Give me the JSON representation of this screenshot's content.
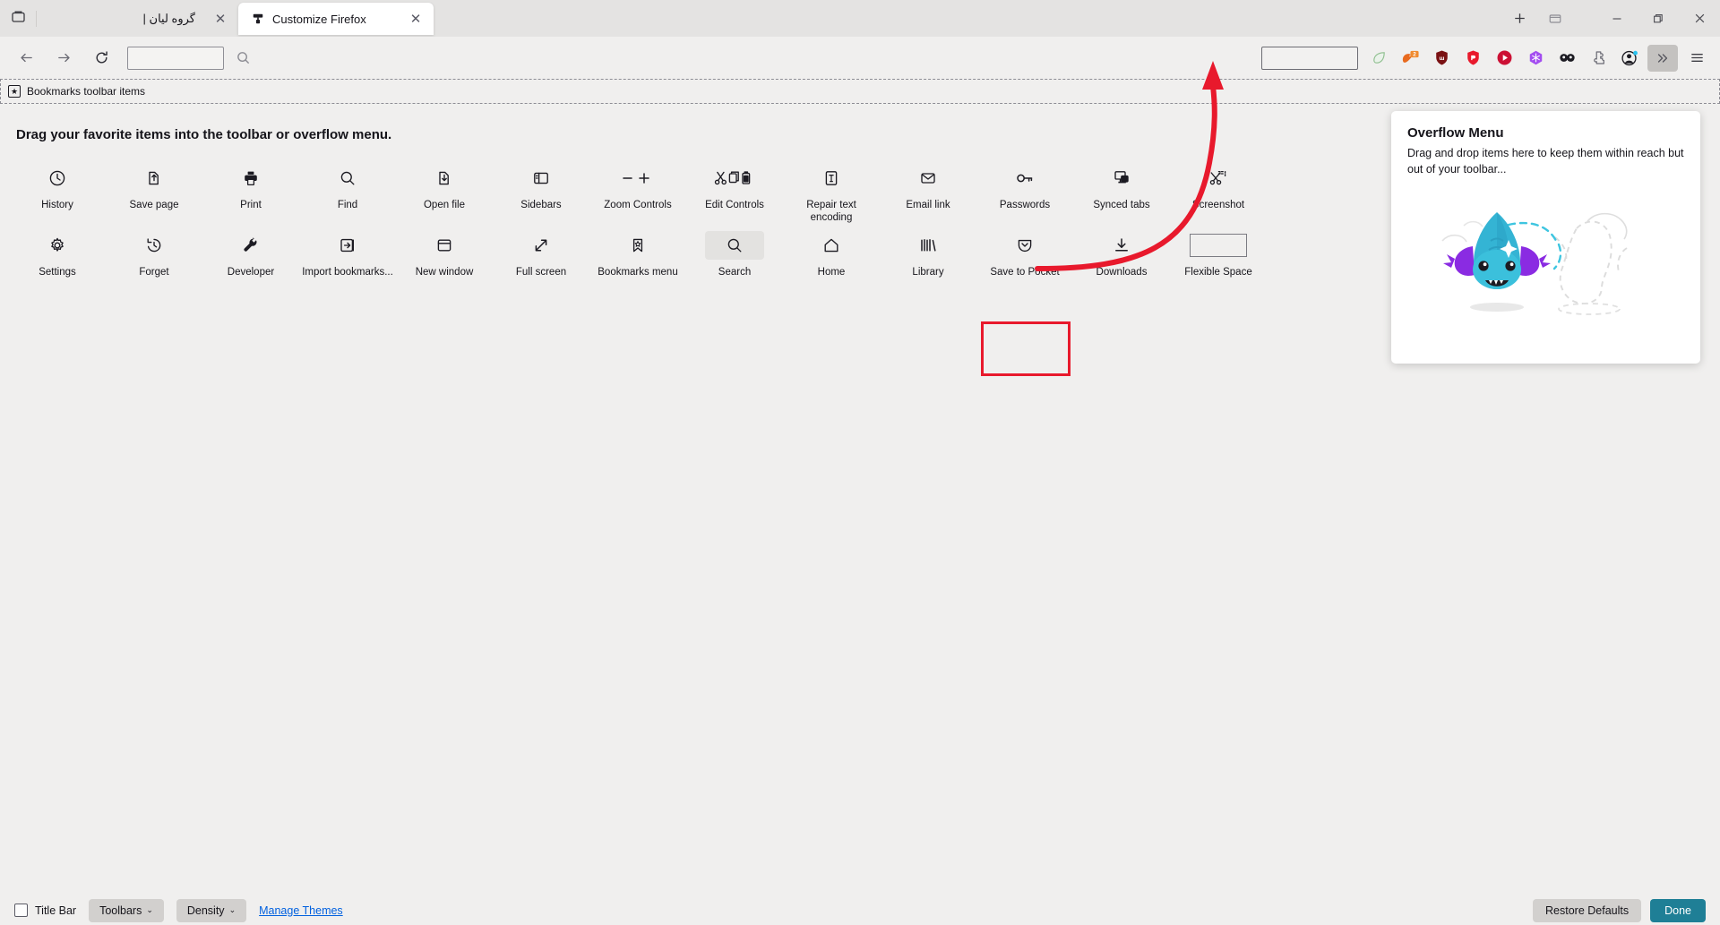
{
  "window": {
    "tab_list_icon": "tab-list-icon",
    "new_tab_label": "+",
    "list_all_tabs_label": "▭",
    "minimize_label": "—",
    "maximize_label": "❐",
    "close_label": "✕"
  },
  "tabs": [
    {
      "title": "گروه لیان |",
      "active": false,
      "close_label": "✕",
      "favicon": "generic-page-icon"
    },
    {
      "title": "Customize Firefox",
      "active": true,
      "close_label": "✕",
      "favicon": "paint-roller-icon"
    }
  ],
  "navbar": {
    "back_icon": "back-arrow-icon",
    "forward_icon": "forward-arrow-icon",
    "reload_icon": "reload-icon",
    "urlbar_value": "",
    "urlbar_placeholder": "",
    "search_icon": "search-icon",
    "secondary_urlbar_value": "",
    "extensions": [
      {
        "name": "leaf-extension-icon",
        "color": "#8fbf8f"
      },
      {
        "name": "firefox-monitor-extension-icon",
        "color": "#e86a1e",
        "badge": "2"
      },
      {
        "name": "ublock-origin-icon",
        "color": "#7a1113"
      },
      {
        "name": "adguard-shield-icon",
        "color": "#e8192c"
      },
      {
        "name": "video-downloader-icon",
        "color": "#cc1034"
      },
      {
        "name": "snowflake-extension-icon",
        "color": "#a34df0"
      },
      {
        "name": "infinity-extension-icon",
        "color": "#1c1b22"
      },
      {
        "name": "extensions-puzzle-icon",
        "color": "#5b5b66"
      },
      {
        "name": "account-avatar-icon",
        "color": "#1c1b22"
      }
    ],
    "overflow_icon": "chevron-double-right-icon",
    "menu_icon": "hamburger-menu-icon"
  },
  "bookmarks_toolbar": {
    "label": "Bookmarks toolbar items",
    "icon": "bookmark-star-icon"
  },
  "customize": {
    "heading": "Drag your favorite items into the toolbar or overflow menu.",
    "palette": [
      {
        "label": "History",
        "icon": "clock-icon",
        "type": "icon"
      },
      {
        "label": "Save page",
        "icon": "save-page-icon",
        "type": "icon"
      },
      {
        "label": "Print",
        "icon": "printer-icon",
        "type": "icon"
      },
      {
        "label": "Find",
        "icon": "magnifier-icon",
        "type": "icon"
      },
      {
        "label": "Open file",
        "icon": "open-file-icon",
        "type": "icon"
      },
      {
        "label": "Sidebars",
        "icon": "sidebar-panel-icon",
        "type": "icon"
      },
      {
        "label": "Zoom Controls",
        "icon": "zoom-minus-plus-icon",
        "type": "icon"
      },
      {
        "label": "Edit Controls",
        "icon": "cut-copy-paste-icon",
        "type": "icon"
      },
      {
        "label": "Repair text encoding",
        "icon": "text-encoding-icon",
        "type": "icon"
      },
      {
        "label": "Email link",
        "icon": "envelope-icon",
        "type": "icon"
      },
      {
        "label": "Passwords",
        "icon": "key-icon",
        "type": "icon"
      },
      {
        "label": "Synced tabs",
        "icon": "synced-tabs-icon",
        "type": "icon"
      },
      {
        "label": "Screenshot",
        "icon": "screenshot-scissors-icon",
        "type": "icon"
      },
      {
        "label": "Settings",
        "icon": "gear-icon",
        "type": "icon"
      },
      {
        "label": "Forget",
        "icon": "forget-clock-icon",
        "type": "icon"
      },
      {
        "label": "Developer",
        "icon": "wrench-icon",
        "type": "icon"
      },
      {
        "label": "Import bookmarks...",
        "icon": "import-arrow-icon",
        "type": "icon"
      },
      {
        "label": "New window",
        "icon": "new-window-icon",
        "type": "icon"
      },
      {
        "label": "Full screen",
        "icon": "fullscreen-arrows-icon",
        "type": "icon"
      },
      {
        "label": "Bookmarks menu",
        "icon": "bookmark-star-icon",
        "type": "icon"
      },
      {
        "label": "Search",
        "icon": "search-icon",
        "type": "icon",
        "highlighted": true
      },
      {
        "label": "Home",
        "icon": "home-icon",
        "type": "icon"
      },
      {
        "label": "Library",
        "icon": "library-icon",
        "type": "icon"
      },
      {
        "label": "Save to Pocket",
        "icon": "pocket-icon",
        "type": "icon",
        "annotated": true
      },
      {
        "label": "Downloads",
        "icon": "download-icon",
        "type": "icon"
      },
      {
        "label": "Flexible Space",
        "icon": "flexible-space-box",
        "type": "box"
      }
    ],
    "annotation": {
      "highlight_color": "#e8192c",
      "arrow_color": "#e8192c",
      "from_item": "Save to Pocket",
      "to_target": "toolbar-url-field"
    }
  },
  "overflow_panel": {
    "title": "Overflow Menu",
    "description": "Drag and drop items here to keep them within reach but out of your toolbar...",
    "artwork": "firefox-axolotl-illustration"
  },
  "bottom_bar": {
    "title_bar_label": "Title Bar",
    "title_bar_checked": false,
    "toolbars_label": "Toolbars",
    "density_label": "Density",
    "caret": "⌄",
    "manage_themes_label": "Manage Themes",
    "restore_defaults_label": "Restore Defaults",
    "done_label": "Done",
    "done_color": "#1f7f96"
  }
}
